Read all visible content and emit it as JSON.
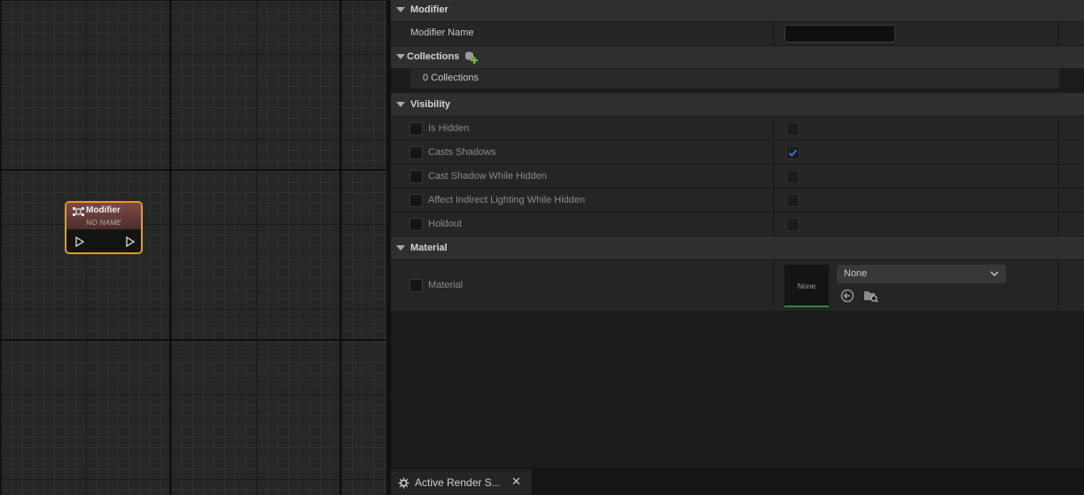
{
  "graph": {
    "node": {
      "title": "Modifier",
      "subtitle": "NO NAME",
      "accent": "#e89a1e"
    }
  },
  "details": {
    "modifier_category": {
      "label": "Modifier"
    },
    "modifier_name": {
      "label": "Modifier Name",
      "value": ""
    },
    "collections_category": {
      "label": "Collections",
      "add_icon": "add-collection-icon"
    },
    "collections_count": {
      "label": "0 Collections"
    },
    "visibility_category": {
      "label": "Visibility"
    },
    "visibility_props": [
      {
        "label": "Is Hidden",
        "checked": false
      },
      {
        "label": "Casts Shadows",
        "checked": true
      },
      {
        "label": "Cast Shadow While Hidden",
        "checked": false
      },
      {
        "label": "Affect Indirect Lighting While Hidden",
        "checked": false
      },
      {
        "label": "Holdout",
        "checked": false
      }
    ],
    "material_category": {
      "label": "Material"
    },
    "material_prop": {
      "label": "Material",
      "thumbnail_text": "None",
      "selected": "None"
    }
  },
  "tabs": [
    {
      "label": "Active Render S...",
      "close": "✕",
      "icon": "render-settings-icon"
    }
  ]
}
